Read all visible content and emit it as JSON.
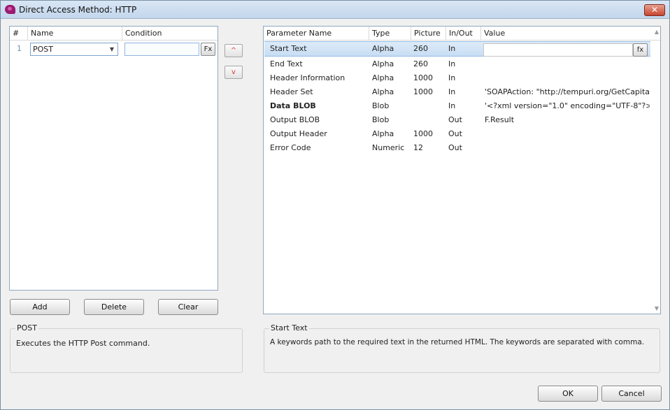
{
  "window": {
    "title": "Direct Access Method: HTTP",
    "close_label": "✕"
  },
  "methods": {
    "columns": [
      "#",
      "Name",
      "Condition"
    ],
    "rows": [
      {
        "num": "1",
        "name": "POST",
        "condition": "",
        "fx_label": "Fx"
      }
    ]
  },
  "move_buttons": {
    "up_label": "^",
    "down_label": "v"
  },
  "actions": {
    "add_label": "Add",
    "delete_label": "Delete",
    "clear_label": "Clear"
  },
  "parameters": {
    "columns": [
      "Parameter Name",
      "Type",
      "Picture",
      "In/Out",
      "Value"
    ],
    "fx_label": "fx",
    "rows": [
      {
        "name": "Start Text",
        "type": "Alpha",
        "picture": "260",
        "inout": "In",
        "value": "",
        "bold": false,
        "selected": true
      },
      {
        "name": "End Text",
        "type": "Alpha",
        "picture": "260",
        "inout": "In",
        "value": "",
        "bold": false,
        "selected": false
      },
      {
        "name": "Header Information",
        "type": "Alpha",
        "picture": "1000",
        "inout": "In",
        "value": "",
        "bold": false,
        "selected": false
      },
      {
        "name": "Header Set",
        "type": "Alpha",
        "picture": "1000",
        "inout": "In",
        "value": "'SOAPAction: \"http://tempuri.org/GetCapitalCi",
        "bold": false,
        "selected": false
      },
      {
        "name": "Data BLOB",
        "type": "Blob",
        "picture": "",
        "inout": "In",
        "value": "'<?xml version=\"1.0\" encoding=\"UTF-8\"?>'",
        "bold": true,
        "selected": false
      },
      {
        "name": "Output BLOB",
        "type": "Blob",
        "picture": "",
        "inout": "Out",
        "value": "F.Result",
        "bold": false,
        "selected": false
      },
      {
        "name": "Output Header",
        "type": "Alpha",
        "picture": "1000",
        "inout": "Out",
        "value": "",
        "bold": false,
        "selected": false
      },
      {
        "name": "Error Code",
        "type": "Numeric",
        "picture": "12",
        "inout": "Out",
        "value": "",
        "bold": false,
        "selected": false
      }
    ]
  },
  "method_info": {
    "title": "POST",
    "description": "Executes the HTTP Post command."
  },
  "param_info": {
    "title": "Start Text",
    "description": "A keywords path to the required text in the returned HTML. The keywords are separated with comma."
  },
  "dialog_buttons": {
    "ok_label": "OK",
    "cancel_label": "Cancel"
  },
  "icons": {
    "app": "app-icon",
    "close": "close-icon",
    "dropdown": "chevron-down-icon",
    "scroll_up": "scroll-up-icon",
    "scroll_down": "scroll-down-icon"
  }
}
